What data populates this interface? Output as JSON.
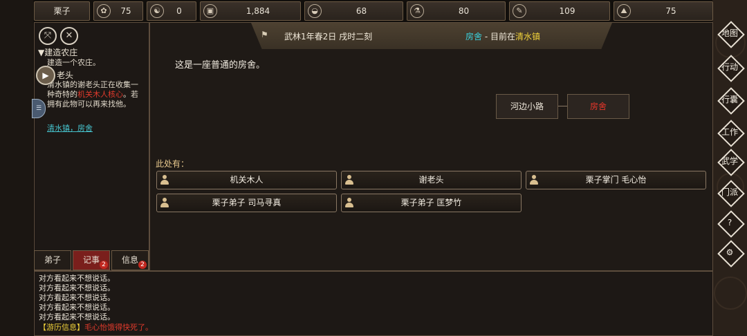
{
  "resources": [
    {
      "icon": "name-tag-icon",
      "value": "栗子",
      "type": "name"
    },
    {
      "icon": "grain-icon",
      "value": "75"
    },
    {
      "icon": "yin-yang-icon",
      "value": "0"
    },
    {
      "icon": "coin-icon",
      "value": "1,884"
    },
    {
      "icon": "food-bowl-icon",
      "value": "68"
    },
    {
      "icon": "flask-icon",
      "value": "80"
    },
    {
      "icon": "scroll-icon",
      "value": "109"
    },
    {
      "icon": "ore-icon",
      "value": "75"
    }
  ],
  "quest": {
    "title": "▼建造农庄",
    "desc": "建造一个农庄。",
    "npc": "老头",
    "text_before": "清水镇的谢老头正在收集一种奇特的",
    "text_highlight": "机关木人核心",
    "text_after": "。若拥有此物可以再来找他。",
    "link": "清水镇，房舍"
  },
  "tabs": [
    {
      "label": "弟子",
      "badge": ""
    },
    {
      "label": "记事",
      "badge": "2"
    },
    {
      "label": "信息",
      "badge": "2"
    }
  ],
  "banner": {
    "date": "武林1年春2日 戌时二刻",
    "place": "房舍",
    "sep": " - 目前在",
    "town": "清水镇"
  },
  "room_desc": "这是一座普通的房舍。",
  "map": {
    "left": "河边小路",
    "right": "房舍"
  },
  "here_label": "此处有：",
  "npcs": [
    "机关木人",
    "谢老头",
    "栗子掌门 毛心怡",
    "栗子弟子 司马寻真",
    "栗子弟子 匡梦竹"
  ],
  "nav": [
    "地图",
    "行动",
    "行囊",
    "工作",
    "武学",
    "门派",
    "?",
    "⚙"
  ],
  "log": {
    "lines": [
      "对方看起来不想说话。",
      "对方看起来不想说话。",
      "对方看起来不想说话。",
      "对方看起来不想说话。",
      "对方看起来不想说话。"
    ],
    "last_tag": "【游历信息】",
    "last_text": "毛心怡饿得快死了。"
  }
}
